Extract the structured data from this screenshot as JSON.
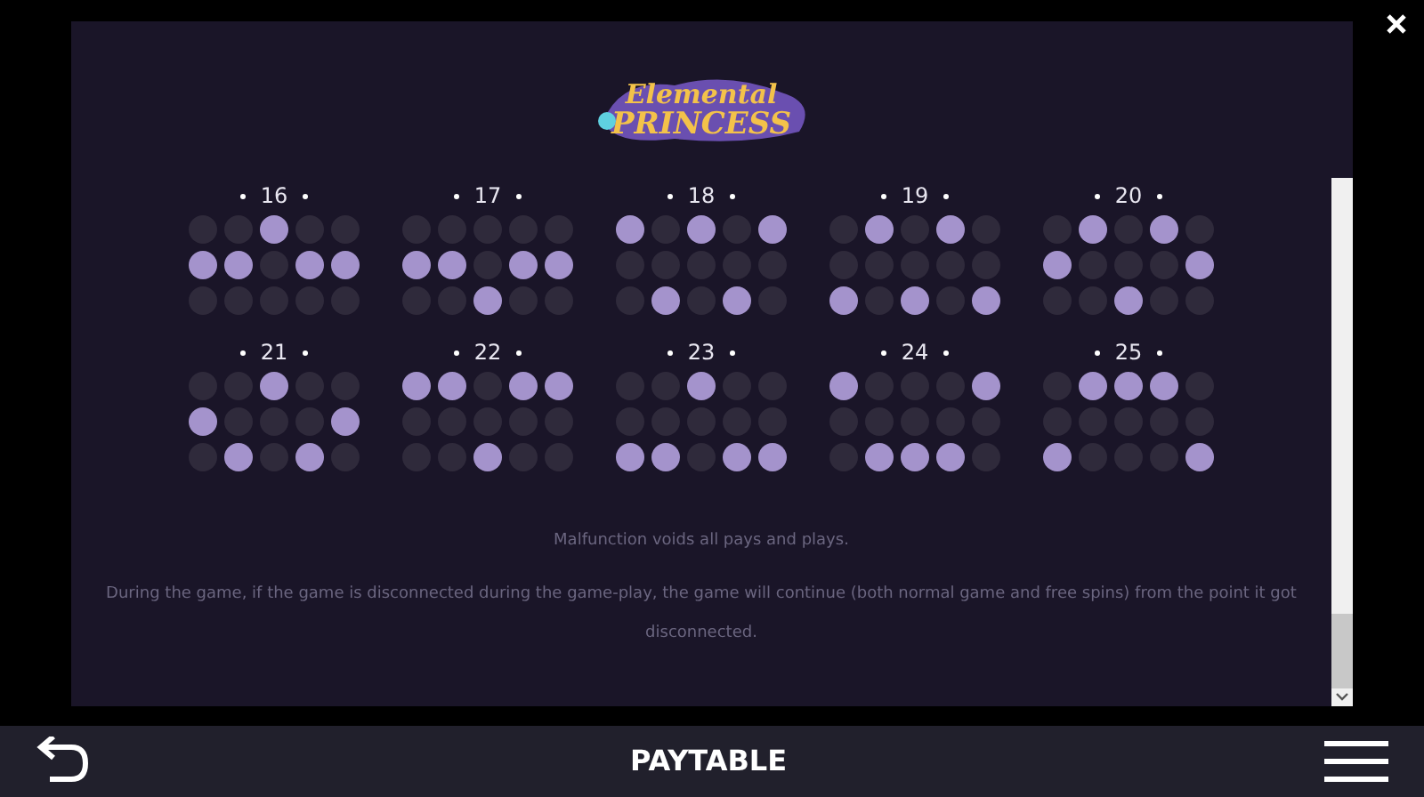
{
  "logo": {
    "line_1": "Elemental",
    "line_2": "PRINCESS"
  },
  "paylines": [
    {
      "number": "16",
      "rows": [
        [
          false,
          false,
          true,
          false,
          false
        ],
        [
          true,
          true,
          false,
          true,
          true
        ],
        [
          false,
          false,
          false,
          false,
          false
        ]
      ]
    },
    {
      "number": "17",
      "rows": [
        [
          false,
          false,
          false,
          false,
          false
        ],
        [
          true,
          true,
          false,
          true,
          true
        ],
        [
          false,
          false,
          true,
          false,
          false
        ]
      ]
    },
    {
      "number": "18",
      "rows": [
        [
          true,
          false,
          true,
          false,
          true
        ],
        [
          false,
          false,
          false,
          false,
          false
        ],
        [
          false,
          true,
          false,
          true,
          false
        ]
      ]
    },
    {
      "number": "19",
      "rows": [
        [
          false,
          true,
          false,
          true,
          false
        ],
        [
          false,
          false,
          false,
          false,
          false
        ],
        [
          true,
          false,
          true,
          false,
          true
        ]
      ]
    },
    {
      "number": "20",
      "rows": [
        [
          false,
          true,
          false,
          true,
          false
        ],
        [
          true,
          false,
          false,
          false,
          true
        ],
        [
          false,
          false,
          true,
          false,
          false
        ]
      ]
    },
    {
      "number": "21",
      "rows": [
        [
          false,
          false,
          true,
          false,
          false
        ],
        [
          true,
          false,
          false,
          false,
          true
        ],
        [
          false,
          true,
          false,
          true,
          false
        ]
      ]
    },
    {
      "number": "22",
      "rows": [
        [
          true,
          true,
          false,
          true,
          true
        ],
        [
          false,
          false,
          false,
          false,
          false
        ],
        [
          false,
          false,
          true,
          false,
          false
        ]
      ]
    },
    {
      "number": "23",
      "rows": [
        [
          false,
          false,
          true,
          false,
          false
        ],
        [
          false,
          false,
          false,
          false,
          false
        ],
        [
          true,
          true,
          false,
          true,
          true
        ]
      ]
    },
    {
      "number": "24",
      "rows": [
        [
          true,
          false,
          false,
          false,
          true
        ],
        [
          false,
          false,
          false,
          false,
          false
        ],
        [
          false,
          true,
          true,
          true,
          false
        ]
      ]
    },
    {
      "number": "25",
      "rows": [
        [
          false,
          true,
          true,
          true,
          false
        ],
        [
          false,
          false,
          false,
          false,
          false
        ],
        [
          true,
          false,
          false,
          false,
          true
        ]
      ]
    }
  ],
  "notes": [
    "Malfunction voids all pays and plays.",
    "During the game, if the game is disconnected during the game-play, the game will continue (both normal game and free spins) from the point it got disconnected."
  ],
  "bottom_bar": {
    "title": "PAYTABLE"
  }
}
